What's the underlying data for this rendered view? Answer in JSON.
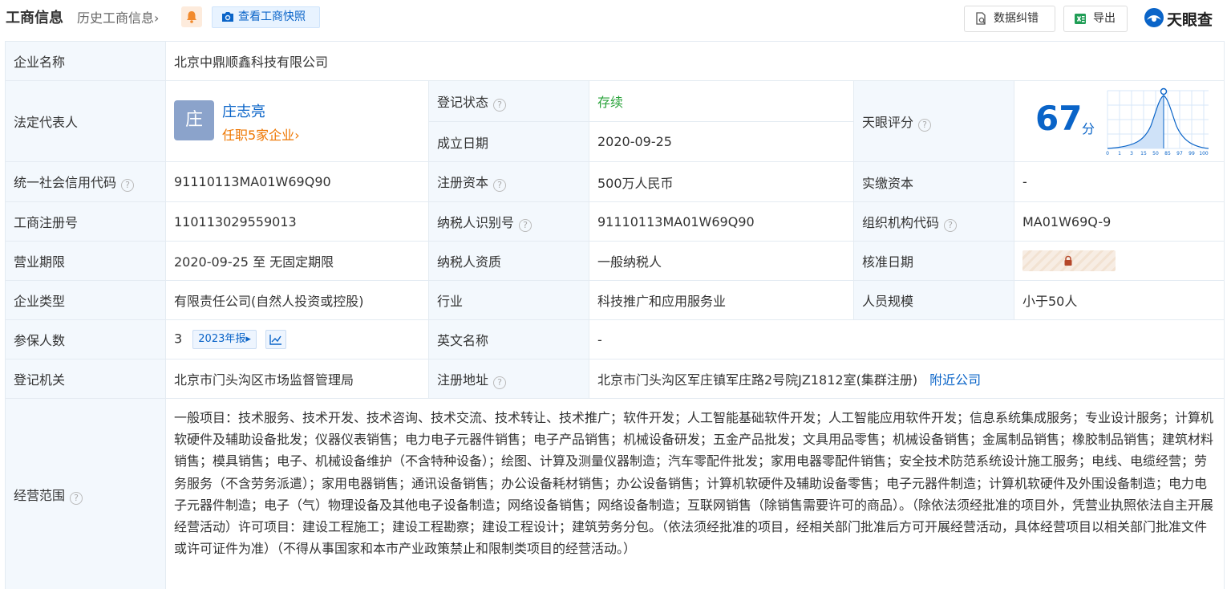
{
  "header": {
    "title": "工商信息",
    "history_label": "历史工商信息",
    "history_chevron": "›",
    "snapshot_label": "查看工商快照",
    "correct_label": "数据纠错",
    "export_label": "导出",
    "logo_text": "天眼查"
  },
  "company": {
    "name_label": "企业名称",
    "name_value": "北京中鼎顺鑫科技有限公司",
    "legal_label": "法定代表人",
    "legal_avatar": "庄",
    "legal_name": "庄志亮",
    "legal_link": "任职5家企业",
    "legal_link_chevron": "›",
    "reg_status_label": "登记状态",
    "reg_status_value": "存续",
    "found_date_label": "成立日期",
    "found_date_value": "2020-09-25",
    "score_label": "天眼评分",
    "score_value": "67",
    "score_unit": "分",
    "score_axis": [
      "0",
      "1",
      "3",
      "15",
      "50",
      "85",
      "97",
      "99",
      "100"
    ],
    "credit_code_label": "统一社会信用代码",
    "credit_code_value": "91110113MA01W69Q90",
    "reg_capital_label": "注册资本",
    "reg_capital_value": "500万人民币",
    "paid_capital_label": "实缴资本",
    "paid_capital_value": "-",
    "biz_reg_no_label": "工商注册号",
    "biz_reg_no_value": "110113029559013",
    "taxpayer_id_label": "纳税人识别号",
    "taxpayer_id_value": "91110113MA01W69Q90",
    "org_code_label": "组织机构代码",
    "org_code_value": "MA01W69Q-9",
    "term_label": "营业期限",
    "term_value": "2020-09-25 至 无固定期限",
    "taxpayer_qual_label": "纳税人资质",
    "taxpayer_qual_value": "一般纳税人",
    "approve_date_label": "核准日期",
    "type_label": "企业类型",
    "type_value": "有限责任公司(自然人投资或控股)",
    "industry_label": "行业",
    "industry_value": "科技推广和应用服务业",
    "staff_size_label": "人员规模",
    "staff_size_value": "小于50人",
    "insured_label": "参保人数",
    "insured_value": "3",
    "insured_report": "2023年报",
    "insured_report_arrow": "▸",
    "english_name_label": "英文名称",
    "english_name_value": "-",
    "reg_authority_label": "登记机关",
    "reg_authority_value": "北京市门头沟区市场监督管理局",
    "reg_address_label": "注册地址",
    "reg_address_value": "北京市门头沟区军庄镇军庄路2号院JZ1812室(集群注册)",
    "nearby_link": "附近公司",
    "scope_label": "经营范围",
    "scope_value": "一般项目：技术服务、技术开发、技术咨询、技术交流、技术转让、技术推广；软件开发；人工智能基础软件开发；人工智能应用软件开发；信息系统集成服务；专业设计服务；计算机软硬件及辅助设备批发；仪器仪表销售；电力电子元器件销售；电子产品销售；机械设备研发；五金产品批发；文具用品零售；机械设备销售；金属制品销售；橡胶制品销售；建筑材料销售；模具销售；电子、机械设备维护（不含特种设备）；绘图、计算及测量仪器制造；汽车零配件批发；家用电器零配件销售；安全技术防范系统设计施工服务；电线、电缆经营；劳务服务（不含劳务派遣）；家用电器销售；通讯设备销售；办公设备耗材销售；办公设备销售；计算机软硬件及辅助设备零售；电子元器件制造；计算机软硬件及外围设备制造；电力电子元器件制造；电子（气）物理设备及其他电子设备制造；网络设备销售；网络设备制造；互联网销售（除销售需要许可的商品）。（除依法须经批准的项目外，凭营业执照依法自主开展经营活动）许可项目：建设工程施工；建设工程勘察；建设工程设计；建筑劳务分包。（依法须经批准的项目，经相关部门批准后方可开展经营活动，具体经营项目以相关部门批准文件或许可证件为准）（不得从事国家和本市产业政策禁止和限制类项目的经营活动。）"
  },
  "help_glyph": "?",
  "colors": {
    "brand_blue": "#0a64c8",
    "status_green": "#2aa33b",
    "accent_orange": "#ee7600",
    "label_bg": "#f3f8fd"
  }
}
